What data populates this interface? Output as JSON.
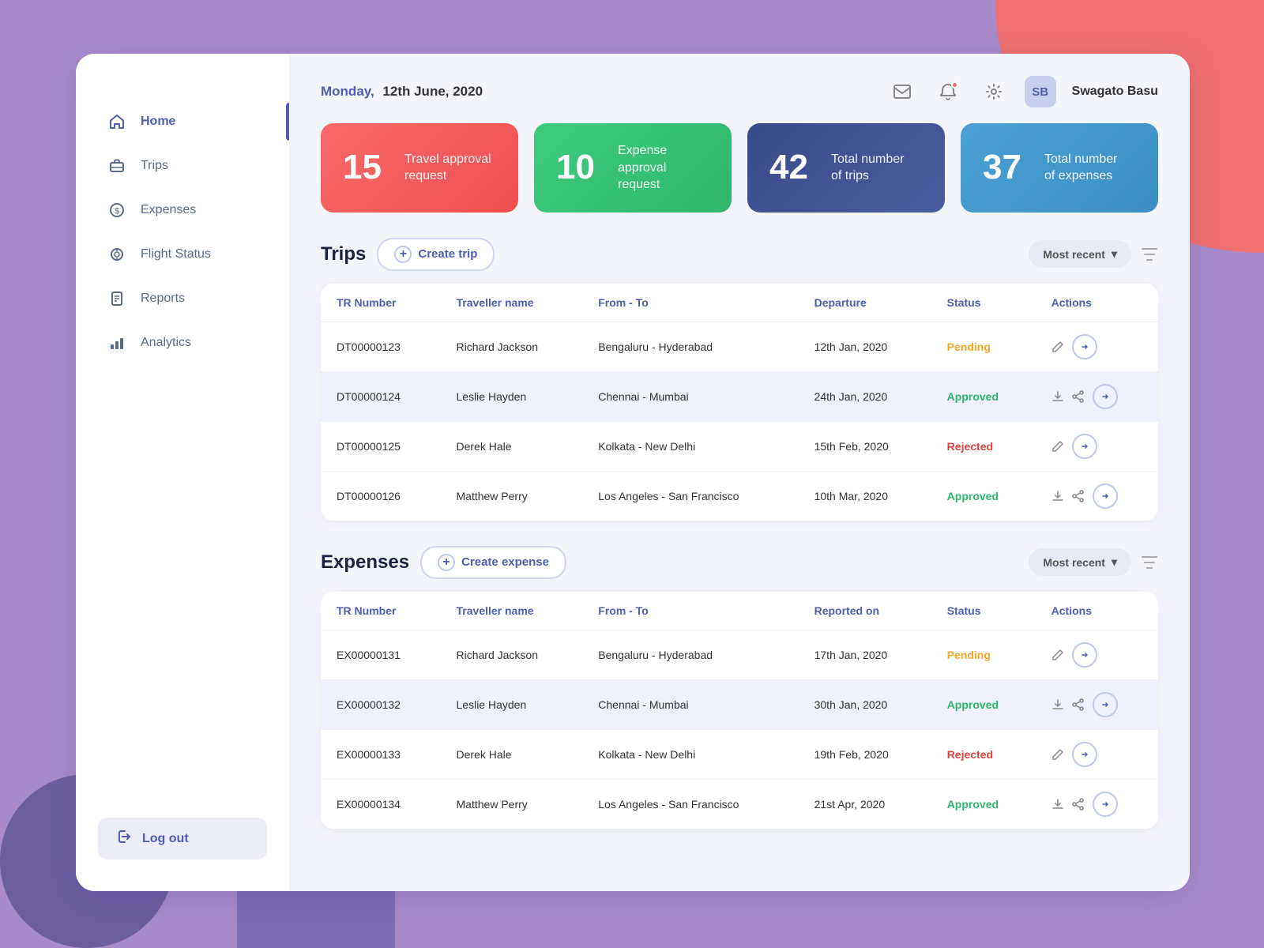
{
  "background": {
    "bg_color": "#a78bca"
  },
  "header": {
    "day": "Monday,",
    "date": "12th June, 2020",
    "icons": {
      "mail": "✉",
      "bell": "🔔",
      "gear": "⚙"
    },
    "user": {
      "initials": "SB",
      "name": "Swagato Basu"
    }
  },
  "stat_cards": [
    {
      "number": "15",
      "label": "Travel approval\nrequest",
      "color": "red"
    },
    {
      "number": "10",
      "label": "Expense approval\nrequest",
      "color": "green"
    },
    {
      "number": "42",
      "label": "Total number\nof trips",
      "color": "navy"
    },
    {
      "number": "37",
      "label": "Total number\nof expenses",
      "color": "blue"
    }
  ],
  "sidebar": {
    "items": [
      {
        "id": "home",
        "label": "Home",
        "icon": "🏠",
        "active": true
      },
      {
        "id": "trips",
        "label": "Trips",
        "icon": "💼",
        "active": false
      },
      {
        "id": "expenses",
        "label": "Expenses",
        "icon": "💲",
        "active": false
      },
      {
        "id": "flight-status",
        "label": "Flight Status",
        "icon": "🔍",
        "active": false
      },
      {
        "id": "reports",
        "label": "Reports",
        "icon": "📋",
        "active": false
      },
      {
        "id": "analytics",
        "label": "Analytics",
        "icon": "📊",
        "active": false
      }
    ],
    "logout_label": "Log out"
  },
  "trips_section": {
    "title": "Trips",
    "create_label": "Create trip",
    "sort_label": "Most recent",
    "columns": [
      "TR Number",
      "Traveller name",
      "From - To",
      "Departure",
      "Status",
      "Actions"
    ],
    "rows": [
      {
        "tr_number": "DT00000123",
        "traveller": "Richard Jackson",
        "route": "Bengaluru - Hyderabad",
        "departure": "12th Jan, 2020",
        "status": "Pending",
        "status_class": "pending",
        "highlighted": false
      },
      {
        "tr_number": "DT00000124",
        "traveller": "Leslie Hayden",
        "route": "Chennai - Mumbai",
        "departure": "24th Jan, 2020",
        "status": "Approved",
        "status_class": "approved",
        "highlighted": true
      },
      {
        "tr_number": "DT00000125",
        "traveller": "Derek Hale",
        "route": "Kolkata - New Delhi",
        "departure": "15th Feb, 2020",
        "status": "Rejected",
        "status_class": "rejected",
        "highlighted": false
      },
      {
        "tr_number": "DT00000126",
        "traveller": "Matthew Perry",
        "route": "Los Angeles - San Francisco",
        "departure": "10th Mar, 2020",
        "status": "Approved",
        "status_class": "approved",
        "highlighted": false
      }
    ]
  },
  "expenses_section": {
    "title": "Expenses",
    "create_label": "Create expense",
    "sort_label": "Most recent",
    "columns": [
      "TR Number",
      "Traveller name",
      "From - To",
      "Reported on",
      "Status",
      "Actions"
    ],
    "rows": [
      {
        "tr_number": "EX00000131",
        "traveller": "Richard Jackson",
        "route": "Bengaluru - Hyderabad",
        "reported_on": "17th Jan, 2020",
        "status": "Pending",
        "status_class": "pending",
        "highlighted": false
      },
      {
        "tr_number": "EX00000132",
        "traveller": "Leslie Hayden",
        "route": "Chennai - Mumbai",
        "reported_on": "30th Jan, 2020",
        "status": "Approved",
        "status_class": "approved",
        "highlighted": true
      },
      {
        "tr_number": "EX00000133",
        "traveller": "Derek Hale",
        "route": "Kolkata - New Delhi",
        "reported_on": "19th Feb, 2020",
        "status": "Rejected",
        "status_class": "rejected",
        "highlighted": false
      },
      {
        "tr_number": "EX00000134",
        "traveller": "Matthew Perry",
        "route": "Los Angeles - San Francisco",
        "reported_on": "21st Apr, 2020",
        "status": "Approved",
        "status_class": "approved",
        "highlighted": false
      }
    ]
  }
}
